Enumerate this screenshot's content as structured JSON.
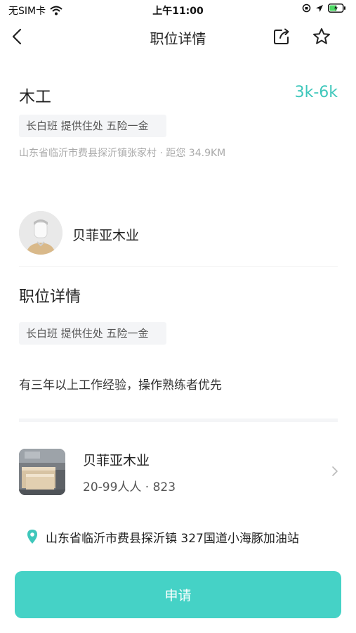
{
  "status_bar": {
    "carrier": "无SIM卡",
    "time": "上午11:00"
  },
  "nav": {
    "title": "职位详情",
    "icons": [
      "back-arrow-icon",
      "share-icon",
      "star-icon"
    ]
  },
  "job": {
    "title": "木工",
    "salary": "3k-6k",
    "tags": "长白班 提供住处 五险一金",
    "location": "山东省临沂市费县探沂镇张家村 · 距您 34.9KM"
  },
  "employer": {
    "name": "贝菲亚木业"
  },
  "details": {
    "section_title": "职位详情",
    "tags": "长白班 提供住处 五险一金",
    "description": "有三年以上工作经验，操作熟练者优先"
  },
  "company_card": {
    "name": "贝菲亚木业",
    "meta": "20-99人人 · 823",
    "address": "山东省临沂市费县探沂镇 327国道小海豚加油站"
  },
  "apply": {
    "label": "申请"
  },
  "colors": {
    "accent": "#3ec7bb",
    "button": "#45d2c6",
    "tag_bg": "#f4f5f7"
  }
}
